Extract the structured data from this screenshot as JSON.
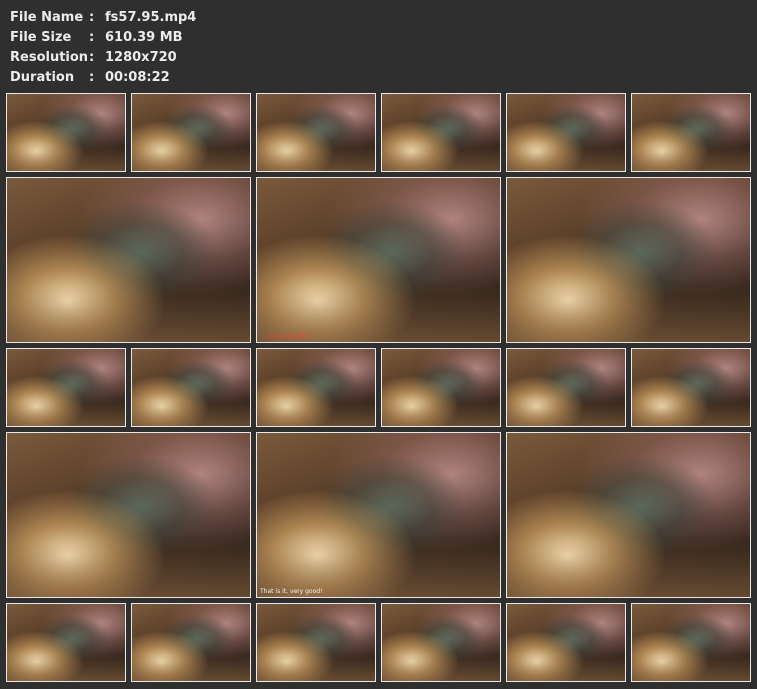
{
  "file_info": [
    {
      "label": "File Name",
      "sep": ":",
      "value": "fs57.95.mp4"
    },
    {
      "label": "File Size",
      "sep": ":",
      "value": "610.39 MB"
    },
    {
      "label": "Resolution",
      "sep": ":",
      "value": "1280x720"
    },
    {
      "label": "Duration",
      "sep": ":",
      "value": "00:08:22"
    }
  ],
  "captions": {
    "large_row2_mid": "... in my mouth?",
    "large_row4_mid": "That is it, very good!"
  }
}
